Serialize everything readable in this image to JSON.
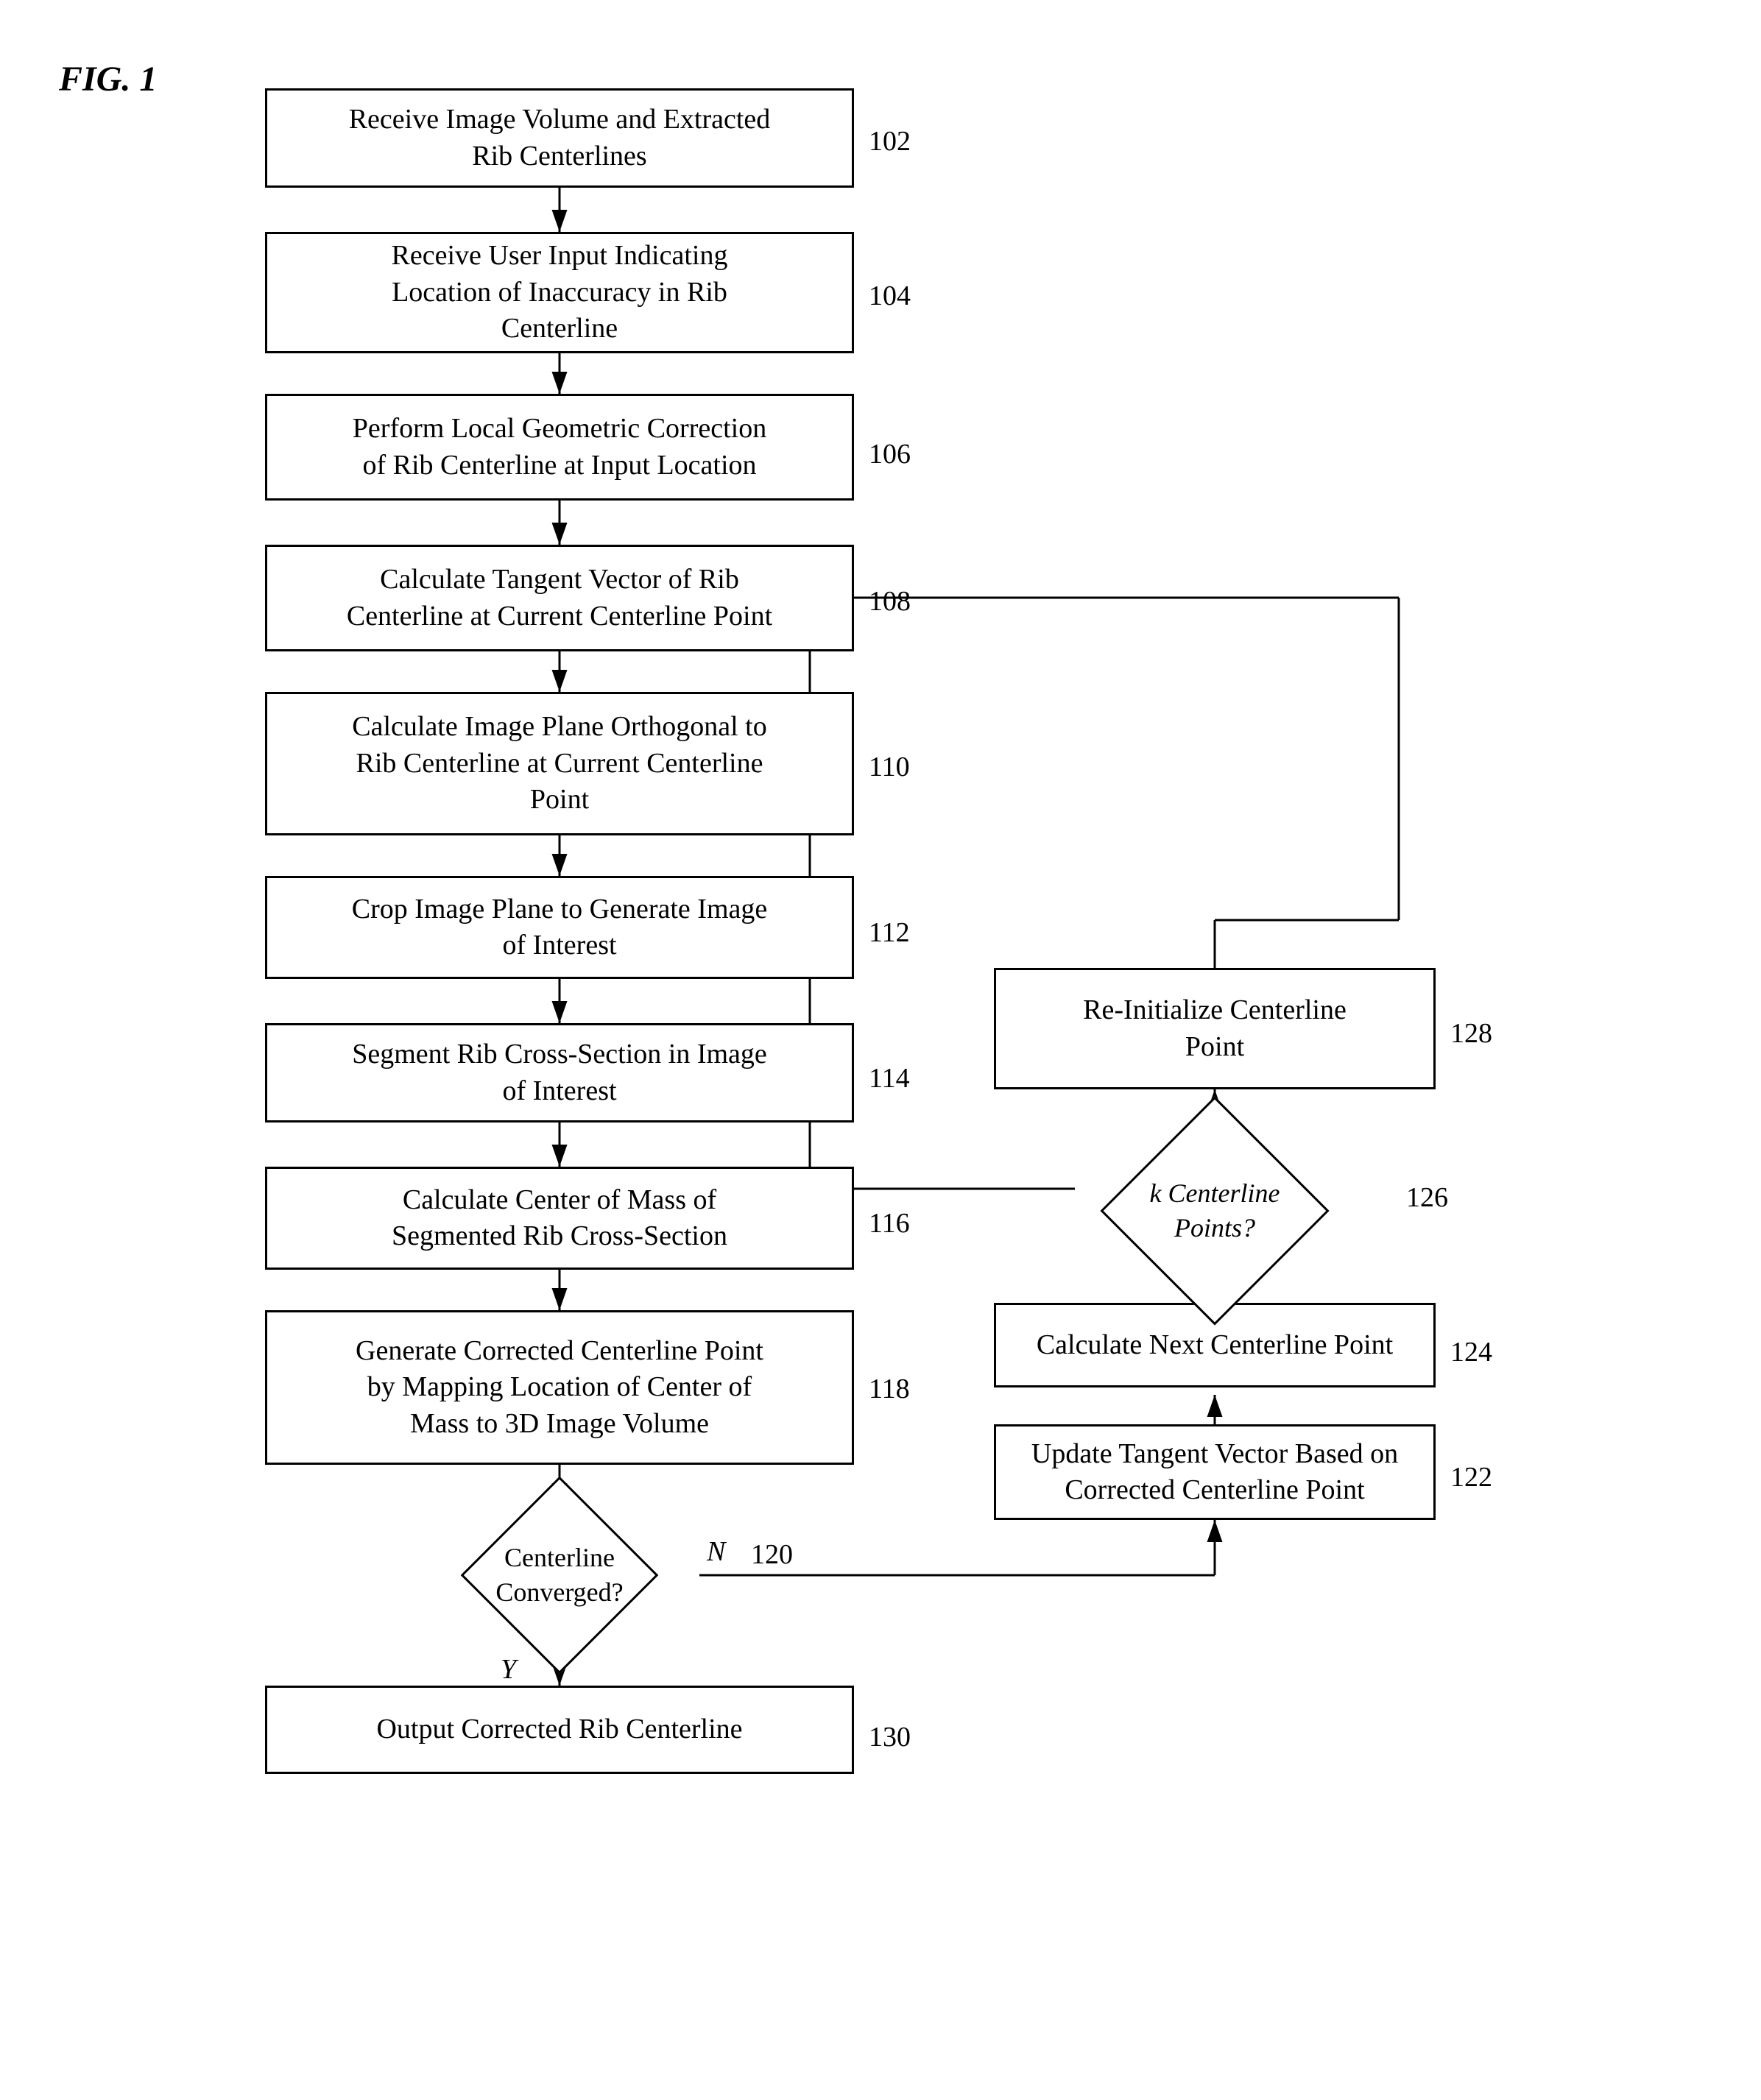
{
  "fig_label": "FIG. 1",
  "steps": [
    {
      "id": "102",
      "label": "Receive Image Volume and Extracted\nRib Centerlines",
      "type": "box"
    },
    {
      "id": "104",
      "label": "Receive User Input Indicating\nLocation of Inaccuracy in Rib\nCenterline",
      "type": "box"
    },
    {
      "id": "106",
      "label": "Perform Local Geometric Correction\nof Rib Centerline at Input Location",
      "type": "box"
    },
    {
      "id": "108",
      "label": "Calculate Tangent Vector of Rib\nCenterline at Current Centerline Point",
      "type": "box"
    },
    {
      "id": "110",
      "label": "Calculate Image Plane Orthogonal to\nRib Centerline at Current Centerline\nPoint",
      "type": "box"
    },
    {
      "id": "112",
      "label": "Crop Image Plane to Generate Image\nof Interest",
      "type": "box"
    },
    {
      "id": "114",
      "label": "Segment Rib Cross-Section in Image\nof Interest",
      "type": "box"
    },
    {
      "id": "116",
      "label": "Calculate Center of Mass of\nSegmented Rib Cross-Section",
      "type": "box"
    },
    {
      "id": "118",
      "label": "Generate Corrected Centerline Point\nby Mapping Location of Center of\nMass to 3D Image Volume",
      "type": "box"
    },
    {
      "id": "120",
      "label": "Centerline\nConverged?",
      "type": "diamond"
    },
    {
      "id": "130",
      "label": "Output Corrected Rib Centerline",
      "type": "box"
    },
    {
      "id": "122",
      "label": "Update Tangent Vector Based on\nCorrected Centerline Point",
      "type": "box"
    },
    {
      "id": "124",
      "label": "Calculate Next Centerline Point",
      "type": "box"
    },
    {
      "id": "126",
      "label": "k Centerline\nPoints?",
      "type": "diamond"
    },
    {
      "id": "128",
      "label": "Re-Initialize Centerline\nPoint",
      "type": "box"
    }
  ],
  "n_label": "N",
  "y_label": "Y",
  "k_label": "k Centerline\nPoints?"
}
